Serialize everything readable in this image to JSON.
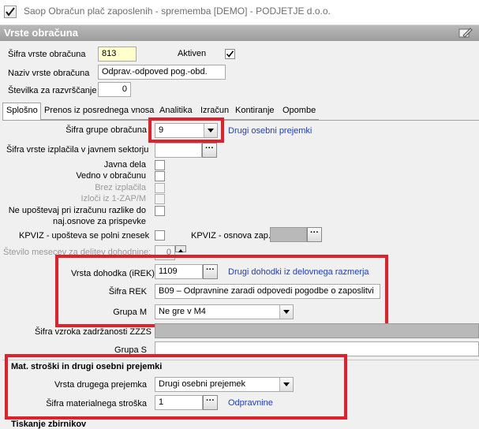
{
  "window": {
    "title": "Saop Obračun plač zaposlenih - sprememba [DEMO] - PODJETJE d.o.o.",
    "icon": "payroll-check-icon"
  },
  "header": {
    "title": "Vrste obračuna",
    "edit_icon": "edit-pencil-icon"
  },
  "top_fields": {
    "sifra_label": "Šifra vrste obračuna",
    "sifra_value": "813",
    "aktiven_label": "Aktiven",
    "aktiven_checked": true,
    "naziv_label": "Naziv vrste obračuna",
    "naziv_value": "Odprav.-odpoved pog.-obd.",
    "stevilka_label": "Številka  za razvrščanje",
    "stevilka_value": "0"
  },
  "tabs": [
    {
      "label": "Splošno",
      "active": true
    },
    {
      "label": "Prenos iz posrednega vnosa",
      "active": false
    },
    {
      "label": "Analitika",
      "active": false
    },
    {
      "label": "Izračun",
      "active": false
    },
    {
      "label": "Kontiranje",
      "active": false
    },
    {
      "label": "Opombe",
      "active": false
    }
  ],
  "general": {
    "grupa_label": "Šifra grupe obračuna",
    "grupa_value": "9",
    "grupa_desc": "Drugi osebni prejemki",
    "izplacila_label": "Šifra vrste izplačila v javnem sektorju",
    "izplacila_value": "",
    "javna_dela_label": "Javna dela",
    "vedno_label": "Vedno v obračunu",
    "brez_label": "Brez izplačila",
    "izloci_label": "Izloči iz 1-ZAP/M",
    "ne_upostevaj_label_1": "Ne upoštevaj pri izračunu razlike do",
    "ne_upostevaj_label_2": "naj.osnove za prispevke",
    "kpviz_label": "KPVIZ - upošteva se polni znesek",
    "kpviz_osnova_label": "KPVIZ - osnova zap.",
    "kpviz_osnova_value": "",
    "stevilo_label": "Število mesecev za delitev dohodnine:",
    "stevilo_value": "0",
    "vrsta_dohodka_label": "Vrsta dohodka (iREK)",
    "vrsta_dohodka_value": "1109",
    "vrsta_dohodka_desc": "Drugi dohodki iz delovnega razmerja",
    "sifra_rek_label": "Šifra REK",
    "sifra_rek_value": "B09 – Odpravnine zaradi odpovedi pogodbe o zaposlitvi",
    "grupa_m_label": "Grupa M",
    "grupa_m_value": "Ne gre v M4",
    "vzrok_label": "Šifra vzroka zadržanosti ZZZS",
    "vzrok_value": "",
    "grupa_s_label": "Grupa S",
    "grupa_s_value": ""
  },
  "mat_section": {
    "title": "Mat. stroški in drugi osebni prejemki",
    "vrsta_label": "Vrsta drugega prejemka",
    "vrsta_value": "Drugi osebni prejemek",
    "sifra_label": "Šifra materialnega stroška",
    "sifra_value": "1",
    "sifra_desc": "Odpravnine"
  },
  "bottom_section": {
    "title": "Tiskanje zbirnikov"
  },
  "colors": {
    "highlight_red": "#e0202a",
    "link_blue": "#1f3ec7",
    "header_gray": "#a8a8a8"
  }
}
